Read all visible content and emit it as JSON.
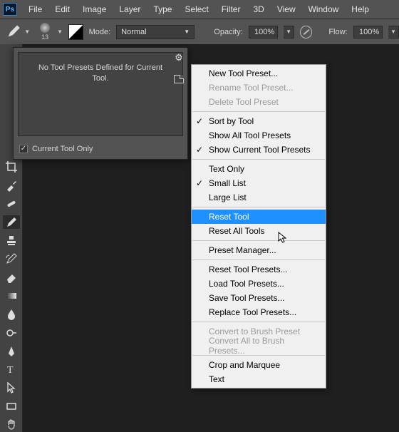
{
  "menubar": [
    "File",
    "Edit",
    "Image",
    "Layer",
    "Type",
    "Select",
    "Filter",
    "3D",
    "View",
    "Window",
    "Help"
  ],
  "logo": "Ps",
  "options": {
    "brush_size": "13",
    "mode_label": "Mode:",
    "mode_value": "Normal",
    "opacity_label": "Opacity:",
    "opacity_value": "100%",
    "flow_label": "Flow:",
    "flow_value": "100%"
  },
  "preset_panel": {
    "empty_text_l1": "No Tool Presets Defined for Current",
    "empty_text_l2": "Tool.",
    "current_only": "Current Tool Only"
  },
  "context_menu": {
    "groups": [
      [
        {
          "label": "New Tool Preset...",
          "disabled": false,
          "checked": false
        },
        {
          "label": "Rename Tool Preset...",
          "disabled": true,
          "checked": false
        },
        {
          "label": "Delete Tool Preset",
          "disabled": true,
          "checked": false
        }
      ],
      [
        {
          "label": "Sort by Tool",
          "disabled": false,
          "checked": true
        },
        {
          "label": "Show All Tool Presets",
          "disabled": false,
          "checked": false
        },
        {
          "label": "Show Current Tool Presets",
          "disabled": false,
          "checked": true
        }
      ],
      [
        {
          "label": "Text Only",
          "disabled": false,
          "checked": false
        },
        {
          "label": "Small List",
          "disabled": false,
          "checked": true
        },
        {
          "label": "Large List",
          "disabled": false,
          "checked": false
        }
      ],
      [
        {
          "label": "Reset Tool",
          "disabled": false,
          "checked": false,
          "highlight": true
        },
        {
          "label": "Reset All Tools",
          "disabled": false,
          "checked": false
        }
      ],
      [
        {
          "label": "Preset Manager...",
          "disabled": false,
          "checked": false
        }
      ],
      [
        {
          "label": "Reset Tool Presets...",
          "disabled": false,
          "checked": false
        },
        {
          "label": "Load Tool Presets...",
          "disabled": false,
          "checked": false
        },
        {
          "label": "Save Tool Presets...",
          "disabled": false,
          "checked": false
        },
        {
          "label": "Replace Tool Presets...",
          "disabled": false,
          "checked": false
        }
      ],
      [
        {
          "label": "Convert to Brush Preset",
          "disabled": true,
          "checked": false
        },
        {
          "label": "Convert All to Brush Presets...",
          "disabled": true,
          "checked": false
        }
      ],
      [
        {
          "label": "Crop and Marquee",
          "disabled": false,
          "checked": false
        },
        {
          "label": "Text",
          "disabled": false,
          "checked": false
        }
      ]
    ]
  }
}
